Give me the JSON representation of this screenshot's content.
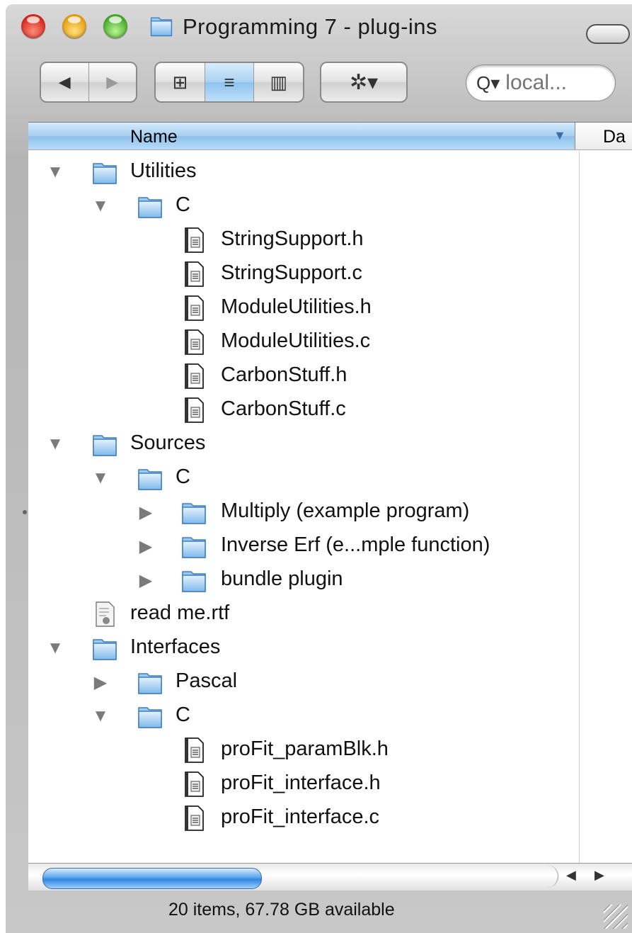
{
  "window": {
    "title": "Programming 7 - plug-ins"
  },
  "toolbar": {
    "back_icon": "◀",
    "forward_icon": "▶",
    "view_icon_icon": "⊞",
    "view_list_icon": "≡",
    "view_column_icon": "▥",
    "action_icon": "✲▾",
    "search_placeholder": "local..."
  },
  "columns": {
    "name": "Name",
    "date_partial": "Da"
  },
  "tree": {
    "r0": {
      "label": "Utilities",
      "expander": "▼"
    },
    "r1": {
      "label": "C",
      "expander": "▼"
    },
    "r2": {
      "label": "StringSupport.h"
    },
    "r3": {
      "label": "StringSupport.c"
    },
    "r4": {
      "label": "ModuleUtilities.h"
    },
    "r5": {
      "label": "ModuleUtilities.c"
    },
    "r6": {
      "label": "CarbonStuff.h"
    },
    "r7": {
      "label": "CarbonStuff.c"
    },
    "r8": {
      "label": "Sources",
      "expander": "▼"
    },
    "r9": {
      "label": "C",
      "expander": "▼"
    },
    "r10": {
      "label": "Multiply (example program)",
      "expander": "▶"
    },
    "r11": {
      "label": "Inverse Erf (e...mple function)",
      "expander": "▶"
    },
    "r12": {
      "label": "bundle plugin",
      "expander": "▶"
    },
    "r13": {
      "label": "read me.rtf"
    },
    "r14": {
      "label": "Interfaces",
      "expander": "▼"
    },
    "r15": {
      "label": "Pascal",
      "expander": "▶"
    },
    "r16": {
      "label": "C",
      "expander": "▼"
    },
    "r17": {
      "label": "proFit_paramBlk.h"
    },
    "r18": {
      "label": "proFit_interface.h"
    },
    "r19": {
      "label": "proFit_interface.c"
    }
  },
  "scrollbar": {
    "left_arrow": "◀",
    "right_arrow": "▶"
  },
  "status": {
    "text": "20 items, 67.78 GB available"
  },
  "colors": {
    "accent": "#8ec3ef",
    "folder": "#6fb1ea",
    "selection_header": "#a6cff1"
  }
}
